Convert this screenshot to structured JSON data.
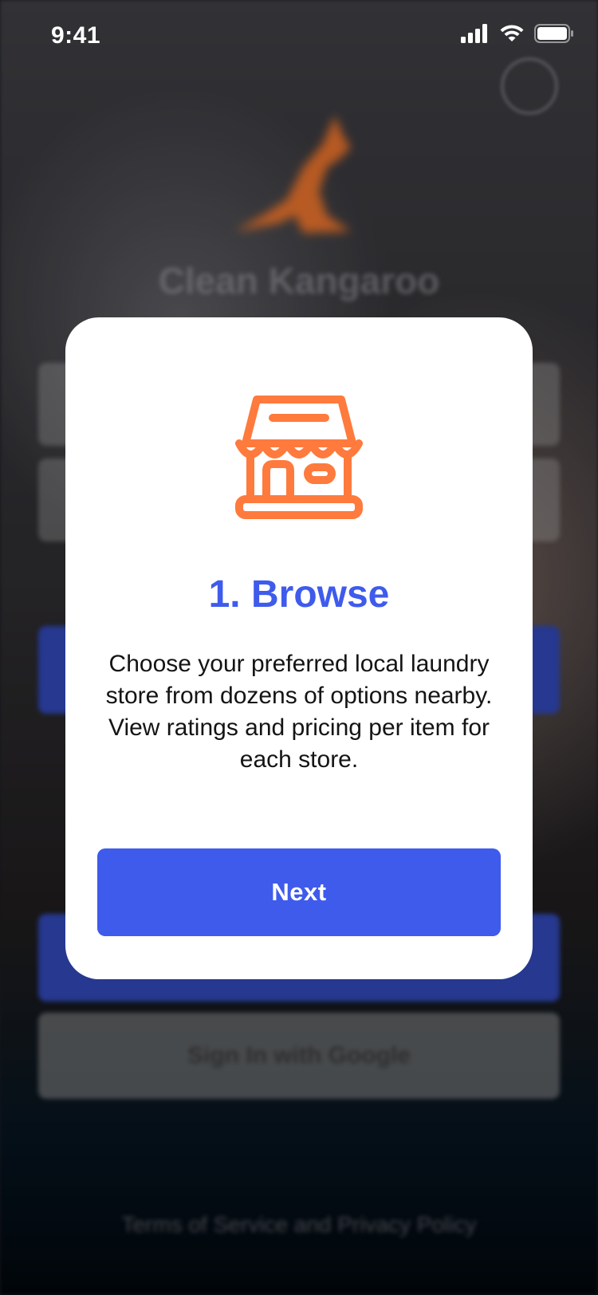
{
  "status_bar": {
    "time": "9:41",
    "icons": [
      "cellular-signal-icon",
      "wifi-icon",
      "battery-icon"
    ]
  },
  "background": {
    "app_title": "Clean Kangaroo",
    "google_button_label": "Sign In with Google",
    "terms_text": "Terms of Service and Privacy Policy",
    "logo_icon": "kangaroo-icon",
    "help_icon": "help-icon"
  },
  "modal": {
    "icon": "store-icon",
    "title": "1. Browse",
    "body": "Choose your preferred local laundry store from dozens of options nearby. View ratings and pricing per item for each store.",
    "next_label": "Next"
  },
  "colors": {
    "accent": "#3f5bec",
    "icon_orange": "#ff7a3d",
    "modal_bg": "#ffffff",
    "text": "#141414"
  }
}
